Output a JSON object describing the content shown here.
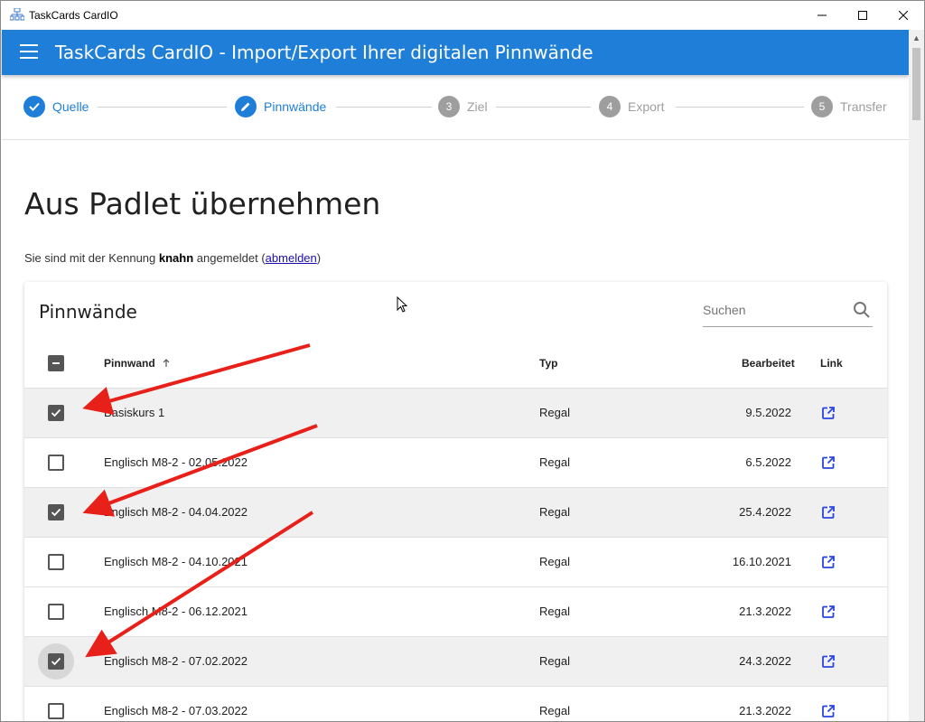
{
  "window": {
    "title": "TaskCards CardIO"
  },
  "appbar": {
    "title": "TaskCards CardIO - Import/Export Ihrer digitalen Pinnwände"
  },
  "stepper": {
    "steps": [
      {
        "label": "Quelle",
        "number": "",
        "state": "done"
      },
      {
        "label": "Pinnwände",
        "number": "",
        "state": "edit"
      },
      {
        "label": "Ziel",
        "number": "3",
        "state": "todo"
      },
      {
        "label": "Export",
        "number": "4",
        "state": "todo"
      },
      {
        "label": "Transfer",
        "number": "5",
        "state": "todo"
      }
    ]
  },
  "main": {
    "heading": "Aus Padlet übernehmen",
    "login_prefix": "Sie sind mit der Kennung ",
    "login_user": "knahn",
    "login_middle": " angemeldet (",
    "logout_link": "abmelden",
    "login_suffix": ")"
  },
  "card": {
    "title": "Pinnwände",
    "search_placeholder": "Suchen",
    "columns": {
      "name": "Pinnwand",
      "type": "Typ",
      "edited": "Bearbeitet",
      "link": "Link"
    },
    "rows": [
      {
        "name": "Basiskurs 1",
        "type": "Regal",
        "edited": "9.5.2022",
        "checked": true
      },
      {
        "name": "Englisch M8-2 - 02.05.2022",
        "type": "Regal",
        "edited": "6.5.2022",
        "checked": false
      },
      {
        "name": "Englisch M8-2 - 04.04.2022",
        "type": "Regal",
        "edited": "25.4.2022",
        "checked": true
      },
      {
        "name": "Englisch M8-2 - 04.10.2021",
        "type": "Regal",
        "edited": "16.10.2021",
        "checked": false
      },
      {
        "name": "Englisch M8-2 - 06.12.2021",
        "type": "Regal",
        "edited": "21.3.2022",
        "checked": false
      },
      {
        "name": "Englisch M8-2 - 07.02.2022",
        "type": "Regal",
        "edited": "24.3.2022",
        "checked": true
      },
      {
        "name": "Englisch M8-2 - 07.03.2022",
        "type": "Regal",
        "edited": "21.3.2022",
        "checked": false
      }
    ]
  },
  "colors": {
    "accent": "#1f7fd8",
    "arrow": "#e8201a"
  }
}
